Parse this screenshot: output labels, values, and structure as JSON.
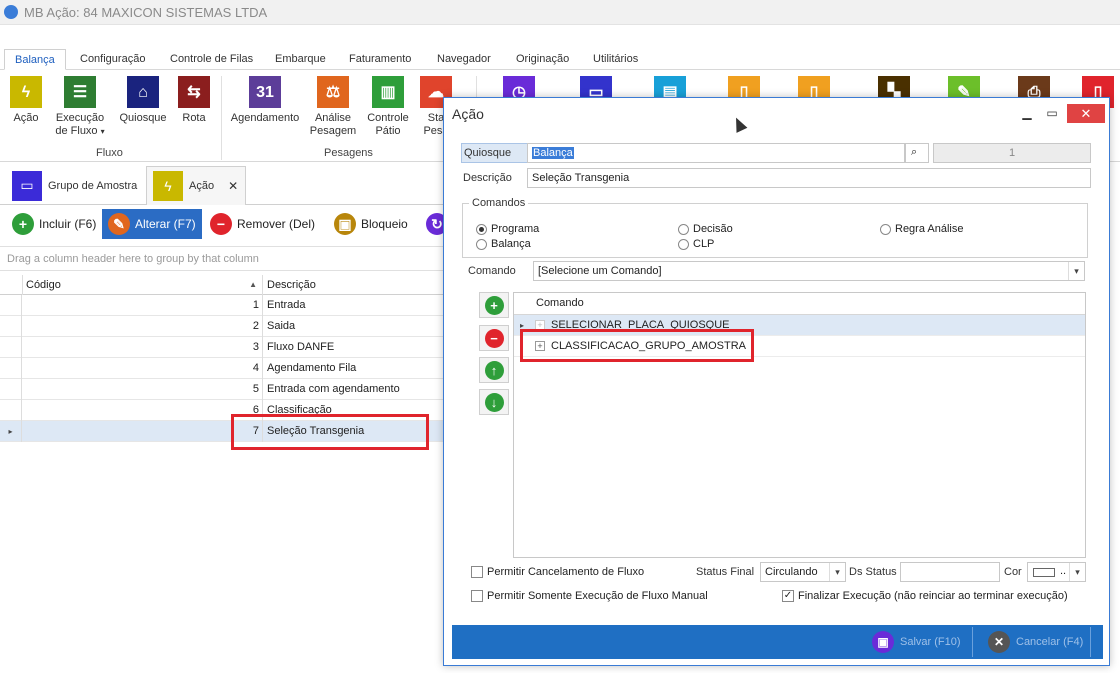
{
  "window": {
    "title": "MB Ação: 84 MAXICON SISTEMAS LTDA"
  },
  "ribbon": {
    "tabs": [
      "Balança",
      "Configuração",
      "Controle de Filas",
      "Embarque",
      "Faturamento",
      "Navegador",
      "Originação",
      "Utilitários"
    ],
    "buttons": {
      "acao": "Ação",
      "execucao_line1": "Execução",
      "execucao_line2": "de Fluxo",
      "quiosque": "Quiosque",
      "rota": "Rota",
      "agendamento": "Agendamento",
      "analise_line1": "Análise",
      "analise_line2": "Pesagem",
      "controle_line1": "Controle",
      "controle_line2": "Pátio",
      "status_line1": "Sta",
      "status_line2": "Pesa"
    },
    "groups": {
      "fluxo": "Fluxo",
      "pesagens": "Pesagens"
    }
  },
  "doc_tabs": {
    "grupo": "Grupo de Amostra",
    "acao": "Ação",
    "close": "✕"
  },
  "toolbar": {
    "incluir": "Incluir (F6)",
    "alterar": "Alterar (F7)",
    "remover": "Remover (Del)",
    "bloqueio": "Bloqueio"
  },
  "grid": {
    "group_hint": "Drag a column header here to group by that column",
    "headers": {
      "codigo": "Código",
      "descricao": "Descrição"
    },
    "rows": [
      {
        "codigo": "1",
        "descricao": "Entrada"
      },
      {
        "codigo": "2",
        "descricao": "Saida"
      },
      {
        "codigo": "3",
        "descricao": "Fluxo DANFE"
      },
      {
        "codigo": "4",
        "descricao": "Agendamento Fila"
      },
      {
        "codigo": "5",
        "descricao": "Entrada com agendamento"
      },
      {
        "codigo": "6",
        "descricao": "Classificação"
      },
      {
        "codigo": "7",
        "descricao": "Seleção Transgenia"
      }
    ]
  },
  "dialog": {
    "title": "Ação",
    "quiosque_label": "Quiosque",
    "quiosque_value": "Balança",
    "quiosque_code": "1",
    "descricao_label": "Descrição",
    "descricao_value": "Seleção Transgenia",
    "comandos_group": "Comandos",
    "radios": {
      "programa": "Programa",
      "decisao": "Decisão",
      "regra": "Regra Análise",
      "balanca": "Balança",
      "clp": "CLP"
    },
    "comando_label": "Comando",
    "comando_value": "[Selecione um Comando]",
    "tree_header": "Comando",
    "tree_rows": [
      "SELECIONAR_PLACA_QUIOSQUE",
      "CLASSIFICACAO_GRUPO_AMOSTRA"
    ],
    "permitir_cancelamento": "Permitir Cancelamento de Fluxo",
    "permitir_somente": "Permitir Somente Execução de Fluxo Manual",
    "status_final_label": "Status Final",
    "status_final_value": "Circulando",
    "ds_status_label": "Ds Status",
    "cor_label": "Cor",
    "finalizar": "Finalizar Execução (não reinciar ao terminar execução)",
    "salvar": "Salvar (F10)",
    "cancelar": "Cancelar (F4)"
  },
  "colors": {
    "accent_blue": "#1f6fc3",
    "highlight_red": "#e0242c",
    "acao_yellow": "#c9b800",
    "green": "#2e9e3a"
  }
}
